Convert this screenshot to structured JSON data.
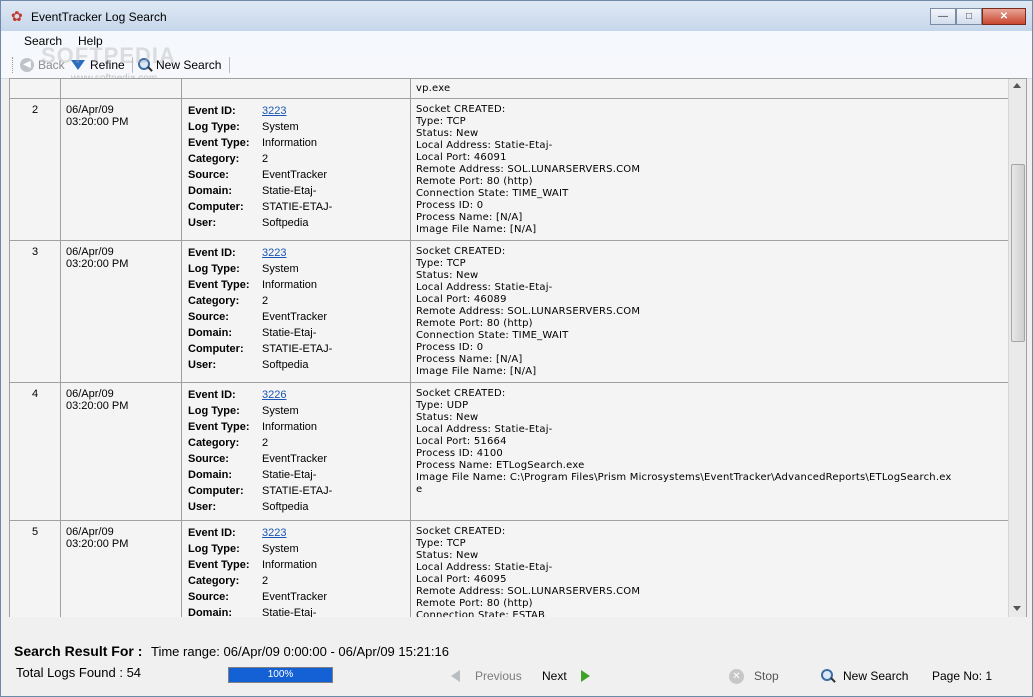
{
  "window": {
    "title": "EventTracker Log Search",
    "controls": [
      "minimize",
      "maximize",
      "close"
    ]
  },
  "menu": [
    "Search",
    "Help"
  ],
  "toolbar": {
    "back": "Back",
    "refine": "Refine",
    "new_search": "New Search"
  },
  "watermark": {
    "brand": "SOFTPEDIA",
    "url": "www.softpedia.com"
  },
  "partial_row_text": "vp.exe",
  "field_labels": {
    "event_id": "Event ID:",
    "log_type": "Log Type:",
    "event_type": "Event Type:",
    "category": "Category:",
    "source": "Source:",
    "domain": "Domain:",
    "computer": "Computer:",
    "user": "User:"
  },
  "rows": [
    {
      "num": "2",
      "date": "06/Apr/09",
      "time": "03:20:00 PM",
      "event_id": "3223",
      "log_type": "System",
      "event_type": "Information",
      "category": "2",
      "source": "EventTracker",
      "domain": "Statie-Etaj-",
      "computer": "STATIE-ETAJ-",
      "user": "Softpedia",
      "description": "Socket CREATED:\nType: TCP\nStatus: New\nLocal Address: Statie-Etaj-\nLocal Port: 46091\nRemote Address: SOL.LUNARSERVERS.COM\nRemote Port: 80 (http)\nConnection State: TIME_WAIT\nProcess ID: 0\nProcess Name: [N/A]\nImage File Name: [N/A]"
    },
    {
      "num": "3",
      "date": "06/Apr/09",
      "time": "03:20:00 PM",
      "event_id": "3223",
      "log_type": "System",
      "event_type": "Information",
      "category": "2",
      "source": "EventTracker",
      "domain": "Statie-Etaj-",
      "computer": "STATIE-ETAJ-",
      "user": "Softpedia",
      "description": "Socket CREATED:\nType: TCP\nStatus: New\nLocal Address: Statie-Etaj-\nLocal Port: 46089\nRemote Address: SOL.LUNARSERVERS.COM\nRemote Port: 80 (http)\nConnection State: TIME_WAIT\nProcess ID: 0\nProcess Name: [N/A]\nImage File Name: [N/A]"
    },
    {
      "num": "4",
      "date": "06/Apr/09",
      "time": "03:20:00 PM",
      "event_id": "3226",
      "log_type": "System",
      "event_type": "Information",
      "category": "2",
      "source": "EventTracker",
      "domain": "Statie-Etaj-",
      "computer": "STATIE-ETAJ-",
      "user": "Softpedia",
      "description": "Socket CREATED:\nType: UDP\nStatus: New\nLocal Address: Statie-Etaj-\nLocal Port: 51664\nProcess ID: 4100\nProcess Name: ETLogSearch.exe\nImage File Name: C:\\Program Files\\Prism Microsystems\\EventTracker\\AdvancedReports\\ETLogSearch.ex\ne"
    },
    {
      "num": "5",
      "date": "06/Apr/09",
      "time": "03:20:00 PM",
      "event_id": "3223",
      "log_type": "System",
      "event_type": "Information",
      "category": "2",
      "source": "EventTracker",
      "domain": "Statie-Etaj-",
      "computer": "",
      "user": "",
      "description": "Socket CREATED:\nType: TCP\nStatus: New\nLocal Address: Statie-Etaj-\nLocal Port: 46095\nRemote Address: SOL.LUNARSERVERS.COM\nRemote Port: 80 (http)\nConnection State: ESTAB"
    }
  ],
  "footer": {
    "search_result_label": "Search Result For :",
    "time_range": "Time range: 06/Apr/09 0:00:00 - 06/Apr/09 15:21:16",
    "total_logs": "Total Logs Found : 54",
    "progress_text": "100%",
    "progress_value": 1.0,
    "previous": "Previous",
    "next": "Next",
    "stop": "Stop",
    "new_search": "New Search",
    "page_no": "Page No: 1"
  }
}
